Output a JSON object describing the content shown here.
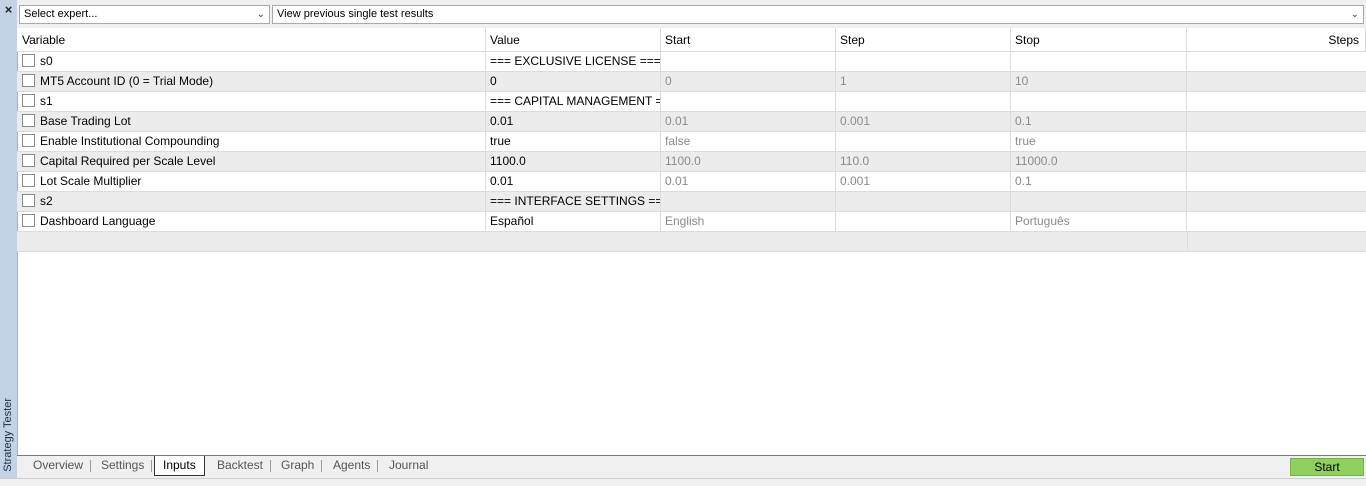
{
  "panel": {
    "close_glyph": "×",
    "vertical_label": "Strategy Tester"
  },
  "selectors": {
    "expert": {
      "value": "Select expert..."
    },
    "results": {
      "value": "View previous single test results"
    }
  },
  "table": {
    "headers": {
      "variable": "Variable",
      "value": "Value",
      "start": "Start",
      "step": "Step",
      "stop": "Stop",
      "steps": "Steps"
    },
    "rows": [
      {
        "variable": "s0",
        "value": "=== EXCLUSIVE LICENSE ===",
        "start": "",
        "step": "",
        "stop": ""
      },
      {
        "variable": "MT5 Account ID (0 = Trial Mode)",
        "value": "0",
        "start": "0",
        "step": "1",
        "stop": "10"
      },
      {
        "variable": "s1",
        "value": "=== CAPITAL MANAGEMENT ===",
        "start": "",
        "step": "",
        "stop": ""
      },
      {
        "variable": "Base Trading Lot",
        "value": "0.01",
        "start": "0.01",
        "step": "0.001",
        "stop": "0.1"
      },
      {
        "variable": "Enable Institutional Compounding",
        "value": "true",
        "start": "false",
        "step": "",
        "stop": "true"
      },
      {
        "variable": "Capital Required per Scale Level",
        "value": "1100.0",
        "start": "1100.0",
        "step": "110.0",
        "stop": "11000.0"
      },
      {
        "variable": "Lot Scale Multiplier",
        "value": "0.01",
        "start": "0.01",
        "step": "0.001",
        "stop": "0.1"
      },
      {
        "variable": "s2",
        "value": "=== INTERFACE SETTINGS ===",
        "start": "",
        "step": "",
        "stop": ""
      },
      {
        "variable": "Dashboard Language",
        "value": "Español",
        "start": "English",
        "step": "",
        "stop": "Português"
      }
    ]
  },
  "tabs": [
    "Overview",
    "Settings",
    "Inputs",
    "Backtest",
    "Graph",
    "Agents",
    "Journal"
  ],
  "active_tab": "Inputs",
  "start_button": "Start",
  "colors": {
    "start_button": "#8fcf5b",
    "side_panel": "#c3d3e6",
    "row_alt": "#ececec"
  }
}
